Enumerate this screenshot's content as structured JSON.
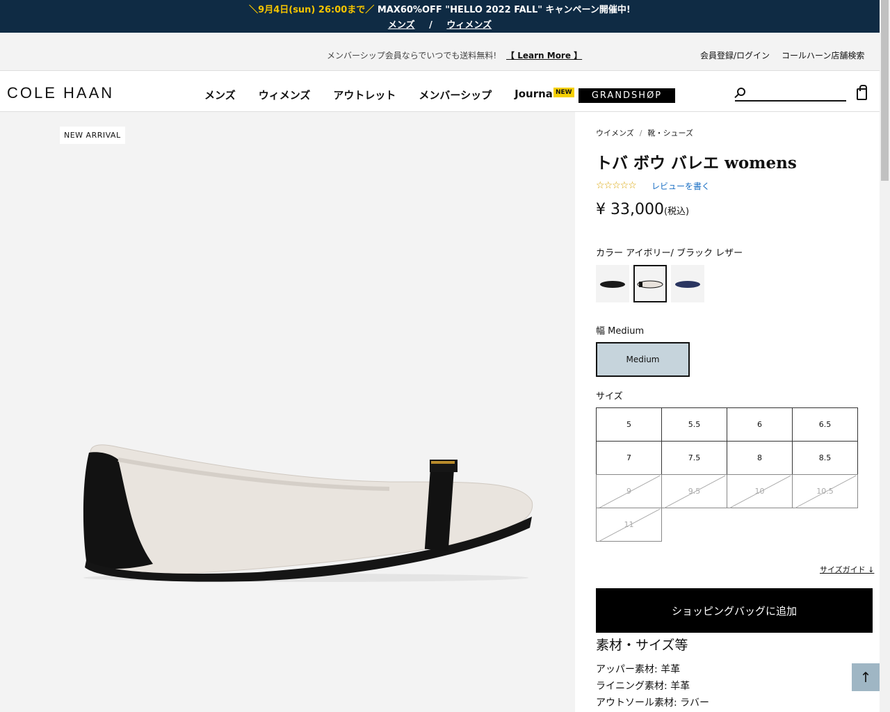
{
  "promo": {
    "deadline": "＼9月4日(sun) 26:00まで／",
    "text": " MAX60%OFF \"HELLO 2022 FALL\" キャンペーン開催中!",
    "link_mens": "メンズ",
    "separator": "/",
    "link_womens": "ウィメンズ"
  },
  "util": {
    "message": "メンバーシップ会員ならでいつでも送料無料!",
    "learn_more": "【 Learn More 】",
    "login": "会員登録/ログイン",
    "stores": "コールハーン店舗検索"
  },
  "header": {
    "logo": "COLE HAAN",
    "nav": [
      "メンズ",
      "ウィメンズ",
      "アウトレット",
      "メンバーシップ",
      "Journal"
    ],
    "new_badge": "NEW",
    "grandshop": "GRANDSHØP",
    "search_placeholder": ""
  },
  "gallery": {
    "badge": "NEW ARRIVAL"
  },
  "product": {
    "breadcrumb": [
      "ウイメンズ",
      "靴・シューズ"
    ],
    "breadcrumb_sep": "/",
    "title": "トバ ボウ バレエ womens",
    "rating_stars": "☆☆☆☆☆",
    "review_link": "レビューを書く",
    "price": "¥ 33,000",
    "tax": "(税込)",
    "color_label": "カラー アイボリー/ ブラック レザー",
    "swatches": [
      {
        "name": "black",
        "color": "#1a1a1a"
      },
      {
        "name": "ivory-black",
        "color": "#e8e2dc"
      },
      {
        "name": "navy",
        "color": "#2a3560"
      }
    ],
    "width_label": "幅 Medium",
    "width_option": "Medium",
    "size_label": "サイズ",
    "sizes": [
      "5",
      "5.5",
      "6",
      "6.5",
      "7",
      "7.5",
      "8",
      "8.5",
      "9",
      "9.5",
      "10",
      "10.5",
      "11"
    ],
    "size_guide": "サイズガイド ↓",
    "add_to_bag": "ショッピングバッグに追加",
    "materials_title": "素材・サイズ等",
    "materials": [
      "アッパー素材: 羊革",
      "ライニング素材: 羊革",
      "アウトソール素材: ラバー"
    ]
  },
  "colors": {
    "promo_bg": "#0f2b44",
    "promo_highlight": "#f5c400",
    "selected_width": "#c6d4dc",
    "link": "#1a6fc4"
  }
}
